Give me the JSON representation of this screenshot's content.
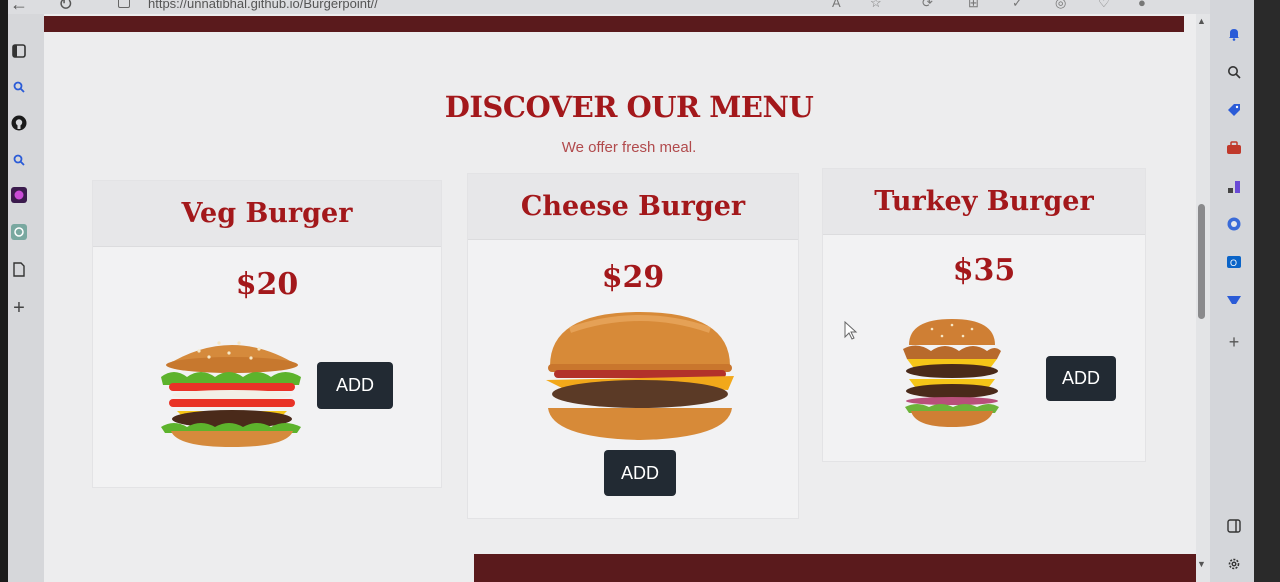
{
  "browser": {
    "url": "https://unnatibhal.github.io/Burgerpoint//"
  },
  "menu": {
    "title": "DISCOVER OUR MENU",
    "subtitle": "We offer fresh meal."
  },
  "cards": [
    {
      "name": "Veg Burger",
      "price": "$20",
      "button": "ADD"
    },
    {
      "name": "Cheese Burger",
      "price": "$29",
      "button": "ADD"
    },
    {
      "name": "Turkey Burger",
      "price": "$35",
      "button": "ADD"
    }
  ],
  "colors": {
    "accent": "#a3181b",
    "button": "#222a33",
    "stripe": "#5a1a1c"
  }
}
